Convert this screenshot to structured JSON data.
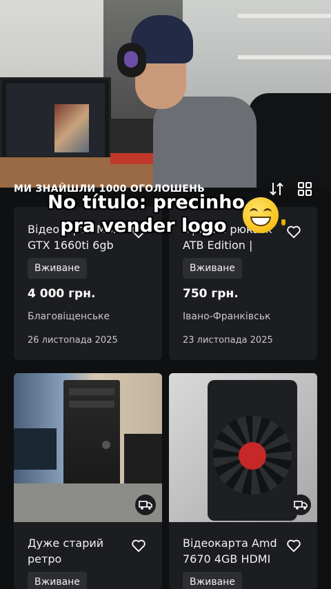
{
  "header": {
    "results_text": "МИ ЗНАЙШЛИ 1000 ОГОЛОШЕНЬ"
  },
  "overlay": {
    "caption_line1": "No título: precinho",
    "caption_line2": "pra vender logo",
    "emoji": "grinning-sweat-face"
  },
  "listings": [
    {
      "title_line1": "Відеокарта MSI",
      "title_line2": "GTX 1660ti 6gb",
      "condition": "Вживане",
      "price": "4 000 грн.",
      "location": "Благовіщенське",
      "date": "26 листопада 2025"
    },
    {
      "title_line1": "Ігровий рюкзак",
      "title_line2": "ATB Edition  |",
      "condition": "Вживане",
      "price": "750 грн.",
      "location": "Івано-Франківськ",
      "date": "23 листопада 2025"
    },
    {
      "title_line1": "Дуже старий",
      "title_line2": "ретро",
      "condition": "Вживане"
    },
    {
      "title_line1": "Відеокарта Amd",
      "title_line2": "7670 4GB HDMI",
      "condition": "Вживане"
    }
  ],
  "colors": {
    "background": "#0f1012",
    "card": "#1c1d20",
    "badge": "#2d2e32"
  },
  "icons": [
    "sort-icon",
    "grid-view-icon",
    "heart-icon",
    "delivery-truck-icon"
  ]
}
